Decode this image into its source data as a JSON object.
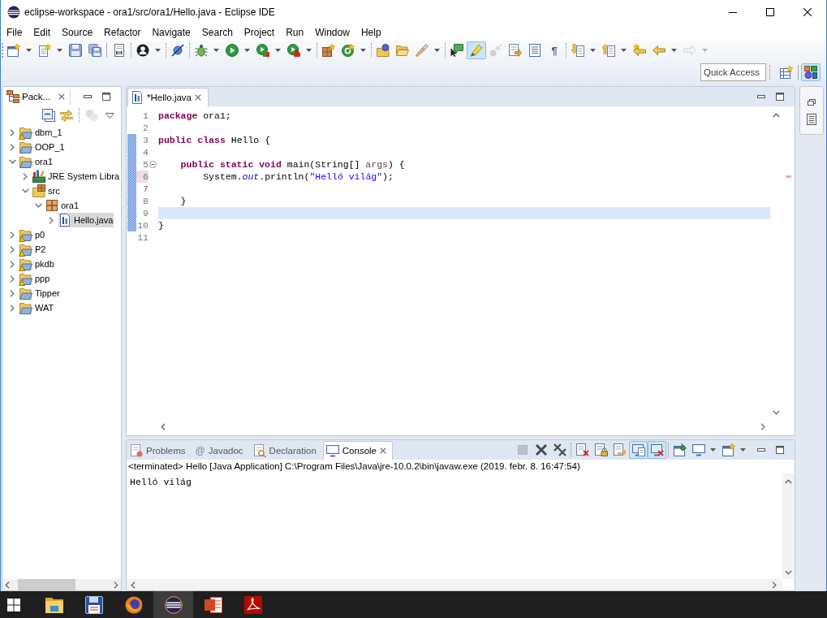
{
  "window": {
    "title": "eclipse-workspace - ora1/src/ora1/Hello.java - Eclipse IDE"
  },
  "menu": [
    {
      "label": "File"
    },
    {
      "label": "Edit"
    },
    {
      "label": "Source"
    },
    {
      "label": "Refactor"
    },
    {
      "label": "Navigate"
    },
    {
      "label": "Search"
    },
    {
      "label": "Project"
    },
    {
      "label": "Run"
    },
    {
      "label": "Window"
    },
    {
      "label": "Help"
    }
  ],
  "toolbar": {
    "groups": [
      {
        "buttons": [
          {
            "dropdown": true,
            "pressed": false,
            "disabled": false
          },
          {
            "dropdown": true,
            "pressed": false,
            "disabled": false
          },
          {
            "dropdown": false,
            "pressed": false,
            "disabled": false
          },
          {
            "dropdown": false,
            "pressed": false,
            "disabled": false
          }
        ]
      },
      {
        "buttons": [
          {
            "dropdown": false,
            "pressed": false,
            "disabled": false
          }
        ]
      },
      {
        "buttons": [
          {
            "dropdown": true,
            "pressed": false,
            "disabled": false
          }
        ]
      },
      {
        "buttons": [
          {
            "dropdown": false,
            "pressed": false,
            "disabled": false
          }
        ]
      },
      {
        "buttons": [
          {
            "dropdown": true,
            "pressed": false,
            "disabled": false
          },
          {
            "dropdown": true,
            "pressed": false,
            "disabled": false
          },
          {
            "dropdown": true,
            "pressed": false,
            "disabled": false
          },
          {
            "dropdown": true,
            "pressed": false,
            "disabled": false
          }
        ]
      },
      {
        "buttons": [
          {
            "dropdown": false,
            "pressed": false,
            "disabled": false
          },
          {
            "dropdown": true,
            "pressed": false,
            "disabled": false
          }
        ]
      },
      {
        "buttons": [
          {
            "dropdown": false,
            "pressed": false,
            "disabled": false
          },
          {
            "dropdown": false,
            "pressed": false,
            "disabled": false
          },
          {
            "dropdown": true,
            "pressed": false,
            "disabled": false
          }
        ]
      },
      {
        "buttons": [
          {
            "dropdown": false,
            "pressed": false,
            "disabled": false
          },
          {
            "dropdown": false,
            "pressed": true,
            "disabled": false
          },
          {
            "dropdown": false,
            "pressed": false,
            "disabled": true
          },
          {
            "dropdown": false,
            "pressed": false,
            "disabled": false
          },
          {
            "dropdown": false,
            "pressed": false,
            "disabled": false
          },
          {
            "text": "¶",
            "dropdown": false,
            "pressed": false,
            "disabled": false
          }
        ]
      },
      {
        "buttons": [
          {
            "dropdown": true,
            "pressed": false,
            "disabled": false
          },
          {
            "dropdown": true,
            "pressed": false,
            "disabled": false
          },
          {
            "dropdown": false,
            "pressed": false,
            "disabled": false
          },
          {
            "dropdown": true,
            "pressed": false,
            "disabled": false
          },
          {
            "dropdown": true,
            "pressed": false,
            "disabled": true
          }
        ]
      }
    ]
  },
  "quick_access": {
    "placeholder": "Quick Access"
  },
  "perspectives": [
    {
      "selected": true
    }
  ],
  "package_explorer": {
    "tabs": [
      {
        "label": "Pack...",
        "selected": true
      }
    ],
    "toolbar": {
      "groups": [
        {
          "buttons": [
            {
              "dropdown": false,
              "pressed": false,
              "disabled": false
            },
            {
              "dropdown": false,
              "pressed": false,
              "disabled": false
            }
          ]
        },
        {
          "buttons": [
            {
              "dropdown": false,
              "pressed": false,
              "disabled": true
            }
          ]
        }
      ]
    },
    "tree": [
      {
        "label": "dbm_1",
        "kind": "project",
        "warning": true,
        "expanded": false,
        "selected": false
      },
      {
        "label": "OOP_1",
        "kind": "project",
        "warning": false,
        "expanded": false,
        "selected": false
      },
      {
        "label": "ora1",
        "kind": "project",
        "warning": false,
        "expanded": true,
        "selected": false,
        "children": [
          {
            "label": "JRE System Libra",
            "kind": "library",
            "warning": false,
            "expanded": false,
            "selected": false
          },
          {
            "label": "src",
            "kind": "source-folder",
            "warning": false,
            "expanded": true,
            "selected": false,
            "children": [
              {
                "label": "ora1",
                "kind": "package",
                "warning": false,
                "expanded": true,
                "selected": false,
                "children": [
                  {
                    "label": "Hello.java",
                    "kind": "java-file",
                    "warning": false,
                    "expanded": false,
                    "selected": true
                  }
                ]
              }
            ]
          }
        ]
      },
      {
        "label": "p0",
        "kind": "project",
        "warning": true,
        "expanded": false,
        "selected": false
      },
      {
        "label": "P2",
        "kind": "project",
        "warning": true,
        "expanded": false,
        "selected": false
      },
      {
        "label": "pkdb",
        "kind": "project",
        "warning": true,
        "expanded": false,
        "selected": false
      },
      {
        "label": "ppp",
        "kind": "project",
        "warning": true,
        "expanded": false,
        "selected": false
      },
      {
        "label": "Tipper",
        "kind": "project",
        "warning": false,
        "expanded": false,
        "selected": false
      },
      {
        "label": "WAT",
        "kind": "project",
        "warning": false,
        "expanded": false,
        "selected": false
      }
    ]
  },
  "editor": {
    "tabs": [
      {
        "label": "*Hello.java",
        "selected": true
      }
    ],
    "lines": [
      {
        "number": "1",
        "changed": false,
        "current": false,
        "marked": false,
        "foldable": false,
        "segments": [
          {
            "kind": "keyword",
            "text": "package"
          },
          {
            "kind": "plain",
            "text": " ora1;"
          }
        ]
      },
      {
        "number": "2",
        "changed": false,
        "current": false,
        "marked": false,
        "foldable": false
      },
      {
        "number": "3",
        "changed": true,
        "current": false,
        "marked": false,
        "foldable": false,
        "segments": [
          {
            "kind": "keyword",
            "text": "public class"
          },
          {
            "kind": "plain",
            "text": " Hello {"
          }
        ]
      },
      {
        "number": "4",
        "changed": true,
        "current": false,
        "marked": false,
        "foldable": false
      },
      {
        "number": "5",
        "changed": true,
        "current": false,
        "marked": false,
        "foldable": true,
        "segments": [
          {
            "kind": "keyword",
            "text": "    public static void"
          },
          {
            "kind": "plain",
            "text": " main(String[] "
          },
          {
            "kind": "param",
            "text": "args"
          },
          {
            "kind": "plain",
            "text": ") {"
          }
        ]
      },
      {
        "number": "6",
        "changed": true,
        "current": false,
        "marked": true,
        "foldable": false,
        "segments": [
          {
            "kind": "plain",
            "text": "        System."
          },
          {
            "kind": "field",
            "text": "out"
          },
          {
            "kind": "plain",
            "text": ".println("
          },
          {
            "kind": "string",
            "text": "\"Helló világ\""
          },
          {
            "kind": "plain",
            "text": ");"
          }
        ]
      },
      {
        "number": "7",
        "changed": true,
        "current": false,
        "marked": false,
        "foldable": false
      },
      {
        "number": "8",
        "changed": true,
        "current": false,
        "marked": false,
        "foldable": false,
        "segments": [
          {
            "kind": "plain",
            "text": "    }"
          }
        ]
      },
      {
        "number": "9",
        "changed": true,
        "current": true,
        "marked": false,
        "foldable": false
      },
      {
        "number": "10",
        "changed": true,
        "current": false,
        "marked": false,
        "foldable": false,
        "segments": [
          {
            "kind": "plain",
            "text": "}"
          }
        ]
      },
      {
        "number": "11",
        "changed": false,
        "current": false,
        "marked": false,
        "foldable": false
      }
    ]
  },
  "console": {
    "tabs": [
      {
        "label": "Problems",
        "selected": false
      },
      {
        "label": "Javadoc",
        "icon_text": "@",
        "selected": false
      },
      {
        "label": "Declaration",
        "selected": false
      },
      {
        "label": "Console",
        "selected": true
      }
    ],
    "toolbar": {
      "groups": [
        {
          "buttons": [
            {
              "dropdown": false,
              "pressed": false,
              "disabled": true
            },
            {
              "dropdown": false,
              "pressed": false,
              "disabled": false
            },
            {
              "dropdown": false,
              "pressed": false,
              "disabled": false
            }
          ]
        },
        {
          "buttons": [
            {
              "dropdown": false,
              "pressed": false,
              "disabled": false
            },
            {
              "dropdown": false,
              "pressed": false,
              "disabled": false
            },
            {
              "dropdown": false,
              "pressed": false,
              "disabled": false
            },
            {
              "dropdown": false,
              "pressed": true,
              "disabled": false
            },
            {
              "dropdown": false,
              "pressed": true,
              "disabled": false
            }
          ]
        },
        {
          "buttons": [
            {
              "dropdown": false,
              "pressed": false,
              "disabled": false
            },
            {
              "dropdown": true,
              "pressed": false,
              "disabled": false
            },
            {
              "dropdown": true,
              "pressed": false,
              "disabled": false
            }
          ]
        }
      ]
    },
    "description": "<terminated> Hello [Java Application] C:\\Program Files\\Java\\jre-10.0.2\\bin\\javaw.exe (2019. febr. 8. 16:47:54)",
    "output": [
      "Helló világ"
    ]
  },
  "taskbar": {
    "apps": [
      {
        "selected": false
      },
      {
        "selected": false
      },
      {
        "selected": false
      },
      {
        "selected": true
      },
      {
        "selected": false
      },
      {
        "selected": false
      }
    ]
  }
}
